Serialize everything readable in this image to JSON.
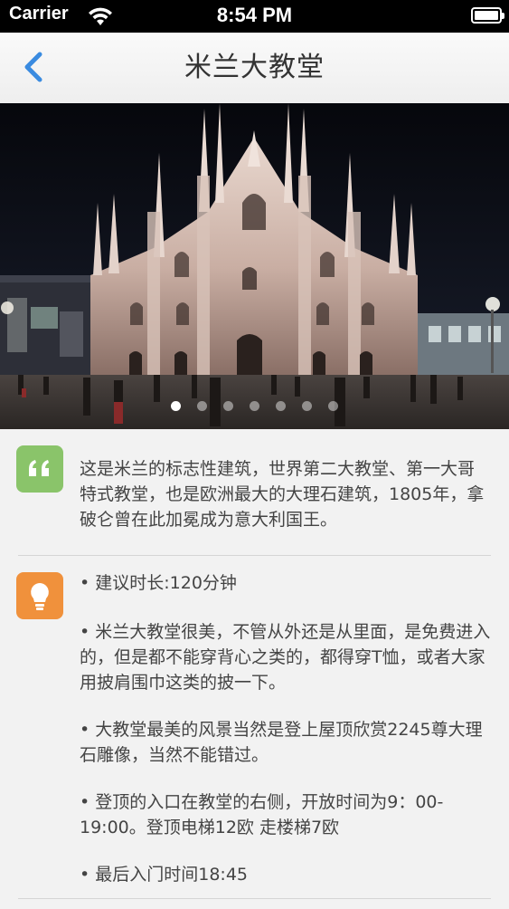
{
  "status_bar": {
    "carrier": "Carrier",
    "time": "8:54 PM",
    "wifi_icon": "wifi-icon",
    "battery_icon": "battery-icon"
  },
  "nav": {
    "back_icon": "chevron-left-icon",
    "title": "米兰大教堂",
    "accent_color": "#3a8be0"
  },
  "hero": {
    "image": "milan-cathedral-photo",
    "total_pages": 7,
    "current_page": 1
  },
  "description": {
    "icon": "quote-icon",
    "icon_color": "#8ac46a",
    "text": "这是米兰的标志性建筑，世界第二大教堂、第一大哥特式教堂，也是欧洲最大的大理石建筑，1805年，拿破仑曾在此加冕成为意大利国王。"
  },
  "tips": {
    "icon": "lightbulb-icon",
    "icon_color": "#f0913c",
    "items": [
      "• 建议时长:120分钟",
      "• 米兰大教堂很美，不管从外还是从里面，是免费进入的，但是都不能穿背心之类的，都得穿T恤，或者大家用披肩围巾这类的披一下。",
      "• 大教堂最美的风景当然是登上屋顶欣赏2245尊大理石雕像，当然不能错过。",
      "• 登顶的入口在教堂的右侧，开放时间为9：00-19:00。登顶电梯12欧 走楼梯7欧",
      "• 最后入门时间18:45"
    ]
  }
}
